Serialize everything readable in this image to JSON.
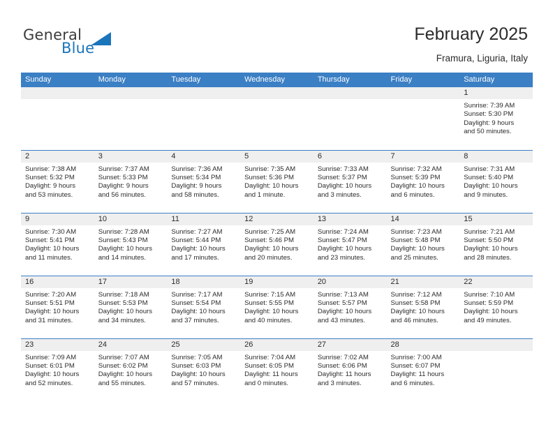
{
  "brand": {
    "name_part1": "General",
    "name_part2": "Blue",
    "accent_color": "#1b75bb",
    "triangle_icon": "triangle-icon"
  },
  "header": {
    "month_title": "February 2025",
    "location": "Framura, Liguria, Italy"
  },
  "calendar": {
    "header_bg": "#3b7fc4",
    "daynum_bg": "#efefef",
    "weekdays": [
      "Sunday",
      "Monday",
      "Tuesday",
      "Wednesday",
      "Thursday",
      "Friday",
      "Saturday"
    ],
    "weeks": [
      [
        {
          "day": "",
          "sunrise": "",
          "sunset": "",
          "daylight1": "",
          "daylight2": ""
        },
        {
          "day": "",
          "sunrise": "",
          "sunset": "",
          "daylight1": "",
          "daylight2": ""
        },
        {
          "day": "",
          "sunrise": "",
          "sunset": "",
          "daylight1": "",
          "daylight2": ""
        },
        {
          "day": "",
          "sunrise": "",
          "sunset": "",
          "daylight1": "",
          "daylight2": ""
        },
        {
          "day": "",
          "sunrise": "",
          "sunset": "",
          "daylight1": "",
          "daylight2": ""
        },
        {
          "day": "",
          "sunrise": "",
          "sunset": "",
          "daylight1": "",
          "daylight2": ""
        },
        {
          "day": "1",
          "sunrise": "Sunrise: 7:39 AM",
          "sunset": "Sunset: 5:30 PM",
          "daylight1": "Daylight: 9 hours",
          "daylight2": "and 50 minutes."
        }
      ],
      [
        {
          "day": "2",
          "sunrise": "Sunrise: 7:38 AM",
          "sunset": "Sunset: 5:32 PM",
          "daylight1": "Daylight: 9 hours",
          "daylight2": "and 53 minutes."
        },
        {
          "day": "3",
          "sunrise": "Sunrise: 7:37 AM",
          "sunset": "Sunset: 5:33 PM",
          "daylight1": "Daylight: 9 hours",
          "daylight2": "and 56 minutes."
        },
        {
          "day": "4",
          "sunrise": "Sunrise: 7:36 AM",
          "sunset": "Sunset: 5:34 PM",
          "daylight1": "Daylight: 9 hours",
          "daylight2": "and 58 minutes."
        },
        {
          "day": "5",
          "sunrise": "Sunrise: 7:35 AM",
          "sunset": "Sunset: 5:36 PM",
          "daylight1": "Daylight: 10 hours",
          "daylight2": "and 1 minute."
        },
        {
          "day": "6",
          "sunrise": "Sunrise: 7:33 AM",
          "sunset": "Sunset: 5:37 PM",
          "daylight1": "Daylight: 10 hours",
          "daylight2": "and 3 minutes."
        },
        {
          "day": "7",
          "sunrise": "Sunrise: 7:32 AM",
          "sunset": "Sunset: 5:39 PM",
          "daylight1": "Daylight: 10 hours",
          "daylight2": "and 6 minutes."
        },
        {
          "day": "8",
          "sunrise": "Sunrise: 7:31 AM",
          "sunset": "Sunset: 5:40 PM",
          "daylight1": "Daylight: 10 hours",
          "daylight2": "and 9 minutes."
        }
      ],
      [
        {
          "day": "9",
          "sunrise": "Sunrise: 7:30 AM",
          "sunset": "Sunset: 5:41 PM",
          "daylight1": "Daylight: 10 hours",
          "daylight2": "and 11 minutes."
        },
        {
          "day": "10",
          "sunrise": "Sunrise: 7:28 AM",
          "sunset": "Sunset: 5:43 PM",
          "daylight1": "Daylight: 10 hours",
          "daylight2": "and 14 minutes."
        },
        {
          "day": "11",
          "sunrise": "Sunrise: 7:27 AM",
          "sunset": "Sunset: 5:44 PM",
          "daylight1": "Daylight: 10 hours",
          "daylight2": "and 17 minutes."
        },
        {
          "day": "12",
          "sunrise": "Sunrise: 7:25 AM",
          "sunset": "Sunset: 5:46 PM",
          "daylight1": "Daylight: 10 hours",
          "daylight2": "and 20 minutes."
        },
        {
          "day": "13",
          "sunrise": "Sunrise: 7:24 AM",
          "sunset": "Sunset: 5:47 PM",
          "daylight1": "Daylight: 10 hours",
          "daylight2": "and 23 minutes."
        },
        {
          "day": "14",
          "sunrise": "Sunrise: 7:23 AM",
          "sunset": "Sunset: 5:48 PM",
          "daylight1": "Daylight: 10 hours",
          "daylight2": "and 25 minutes."
        },
        {
          "day": "15",
          "sunrise": "Sunrise: 7:21 AM",
          "sunset": "Sunset: 5:50 PM",
          "daylight1": "Daylight: 10 hours",
          "daylight2": "and 28 minutes."
        }
      ],
      [
        {
          "day": "16",
          "sunrise": "Sunrise: 7:20 AM",
          "sunset": "Sunset: 5:51 PM",
          "daylight1": "Daylight: 10 hours",
          "daylight2": "and 31 minutes."
        },
        {
          "day": "17",
          "sunrise": "Sunrise: 7:18 AM",
          "sunset": "Sunset: 5:53 PM",
          "daylight1": "Daylight: 10 hours",
          "daylight2": "and 34 minutes."
        },
        {
          "day": "18",
          "sunrise": "Sunrise: 7:17 AM",
          "sunset": "Sunset: 5:54 PM",
          "daylight1": "Daylight: 10 hours",
          "daylight2": "and 37 minutes."
        },
        {
          "day": "19",
          "sunrise": "Sunrise: 7:15 AM",
          "sunset": "Sunset: 5:55 PM",
          "daylight1": "Daylight: 10 hours",
          "daylight2": "and 40 minutes."
        },
        {
          "day": "20",
          "sunrise": "Sunrise: 7:13 AM",
          "sunset": "Sunset: 5:57 PM",
          "daylight1": "Daylight: 10 hours",
          "daylight2": "and 43 minutes."
        },
        {
          "day": "21",
          "sunrise": "Sunrise: 7:12 AM",
          "sunset": "Sunset: 5:58 PM",
          "daylight1": "Daylight: 10 hours",
          "daylight2": "and 46 minutes."
        },
        {
          "day": "22",
          "sunrise": "Sunrise: 7:10 AM",
          "sunset": "Sunset: 5:59 PM",
          "daylight1": "Daylight: 10 hours",
          "daylight2": "and 49 minutes."
        }
      ],
      [
        {
          "day": "23",
          "sunrise": "Sunrise: 7:09 AM",
          "sunset": "Sunset: 6:01 PM",
          "daylight1": "Daylight: 10 hours",
          "daylight2": "and 52 minutes."
        },
        {
          "day": "24",
          "sunrise": "Sunrise: 7:07 AM",
          "sunset": "Sunset: 6:02 PM",
          "daylight1": "Daylight: 10 hours",
          "daylight2": "and 55 minutes."
        },
        {
          "day": "25",
          "sunrise": "Sunrise: 7:05 AM",
          "sunset": "Sunset: 6:03 PM",
          "daylight1": "Daylight: 10 hours",
          "daylight2": "and 57 minutes."
        },
        {
          "day": "26",
          "sunrise": "Sunrise: 7:04 AM",
          "sunset": "Sunset: 6:05 PM",
          "daylight1": "Daylight: 11 hours",
          "daylight2": "and 0 minutes."
        },
        {
          "day": "27",
          "sunrise": "Sunrise: 7:02 AM",
          "sunset": "Sunset: 6:06 PM",
          "daylight1": "Daylight: 11 hours",
          "daylight2": "and 3 minutes."
        },
        {
          "day": "28",
          "sunrise": "Sunrise: 7:00 AM",
          "sunset": "Sunset: 6:07 PM",
          "daylight1": "Daylight: 11 hours",
          "daylight2": "and 6 minutes."
        },
        {
          "day": "",
          "sunrise": "",
          "sunset": "",
          "daylight1": "",
          "daylight2": ""
        }
      ]
    ]
  }
}
